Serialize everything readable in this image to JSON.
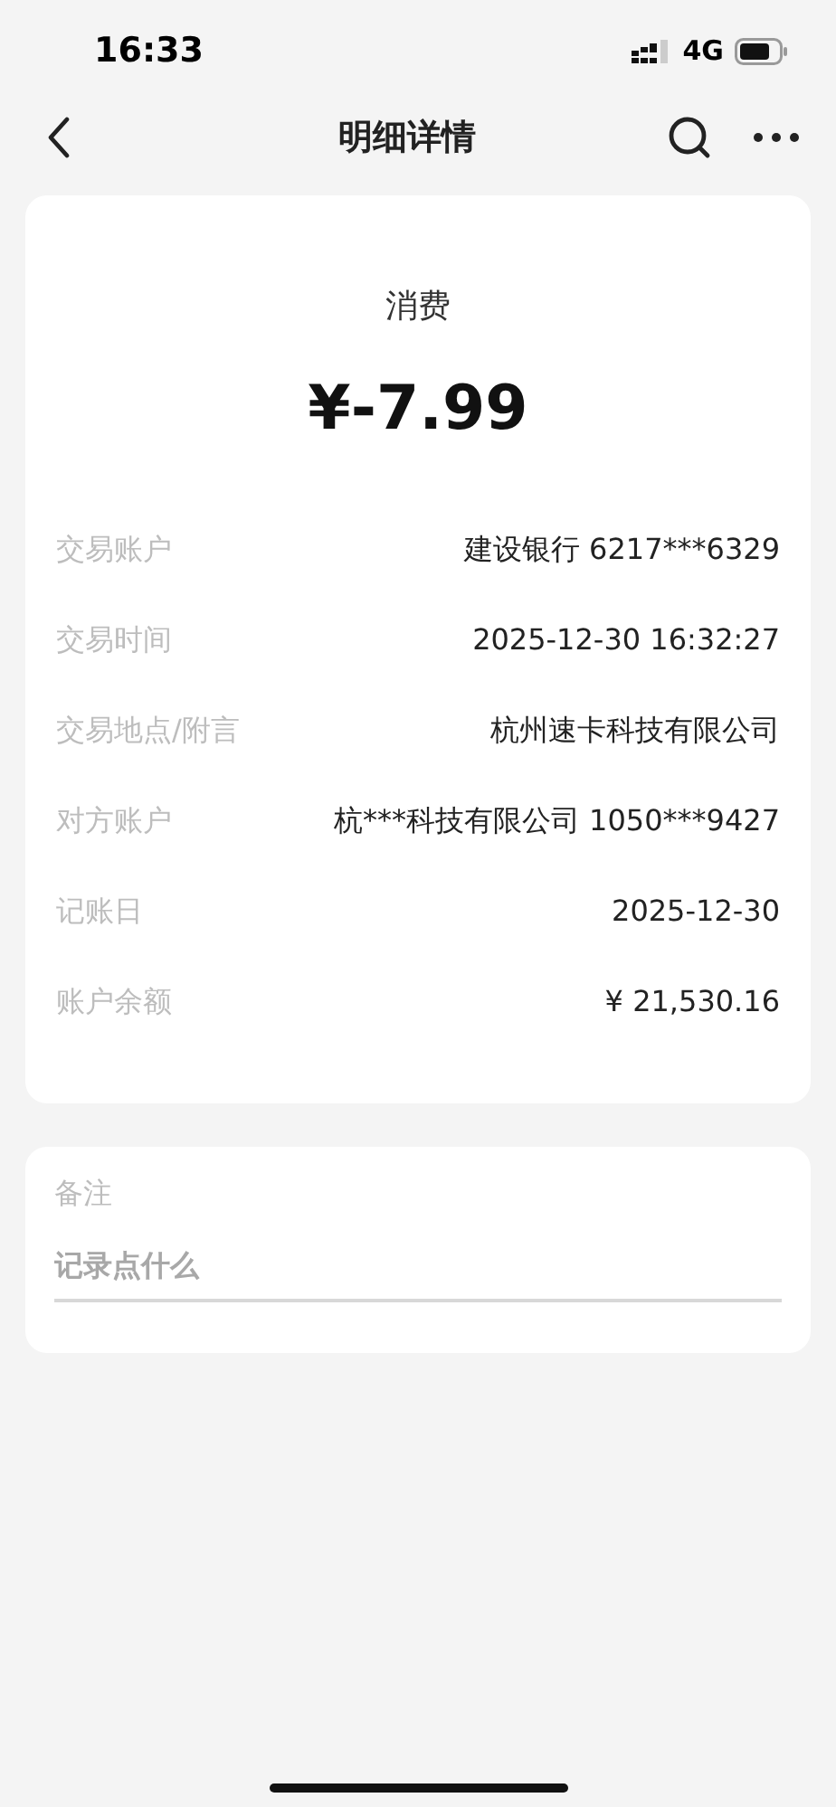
{
  "status_bar": {
    "time": "16:33",
    "network": "4G"
  },
  "header": {
    "title": "明细详情"
  },
  "summary": {
    "type": "消费",
    "amount": "¥-7.99"
  },
  "details": [
    {
      "label": "交易账户",
      "value": "建设银行 6217***6329"
    },
    {
      "label": "交易时间",
      "value": "2025-12-30 16:32:27"
    },
    {
      "label": "交易地点/附言",
      "value": "杭州速卡科技有限公司"
    },
    {
      "label": "对方账户",
      "value": "杭***科技有限公司 1050***9427"
    },
    {
      "label": "记账日",
      "value": "2025-12-30"
    },
    {
      "label": "账户余额",
      "value": "¥ 21,530.16"
    }
  ],
  "note": {
    "label": "备注",
    "placeholder": "记录点什么"
  }
}
